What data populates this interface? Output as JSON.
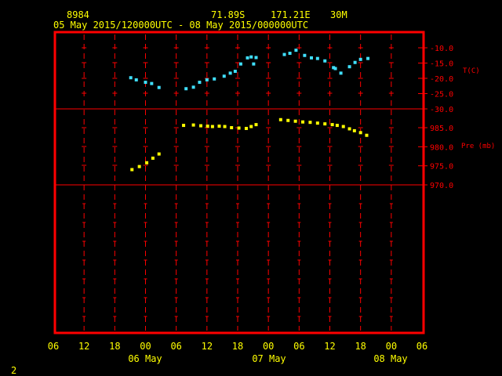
{
  "header": {
    "station": "8984",
    "lat": "71.89S",
    "lon": "171.21E",
    "elev": "30M",
    "period": "05 May 2015/120000UTC - 08 May 2015/000000UTC"
  },
  "page_number": "2",
  "colors": {
    "background": "#000000",
    "frame": "#ff0000",
    "text": "#ffff00",
    "temperature": "#40e0ff",
    "pressure": "#ffff00"
  },
  "chart_data": [
    {
      "type": "scatter",
      "xlabel": "",
      "ylabel": "T(C)",
      "ylim": [
        -30,
        -10
      ],
      "yticks": [
        "-10.0",
        "-15.0",
        "-20.0",
        "-25.0",
        "-30.0"
      ],
      "series": [
        {
          "x": [
            12.6,
            13.5,
            15.0,
            16.0,
            17.2,
            21.6,
            22.8,
            23.8,
            25.0,
            26.2,
            27.8,
            28.8,
            29.6,
            30.5,
            31.6,
            32.2,
            32.6,
            33.0,
            37.6,
            38.5,
            39.5,
            40.9,
            42.0,
            43.0,
            44.2,
            45.6,
            45.9,
            46.8,
            48.2,
            49.1,
            50.0,
            51.2
          ],
          "y": [
            -19.8,
            -20.5,
            -21.3,
            -21.7,
            -23.0,
            -23.4,
            -22.9,
            -21.3,
            -20.5,
            -20.2,
            -19.3,
            -18.3,
            -17.7,
            -15.3,
            -13.3,
            -13.0,
            -15.3,
            -13.2,
            -12.2,
            -11.8,
            -10.8,
            -12.5,
            -13.3,
            -13.5,
            -14.3,
            -16.5,
            -16.8,
            -18.3,
            -16.2,
            -14.8,
            -13.8,
            -13.5
          ]
        }
      ]
    },
    {
      "type": "scatter",
      "xlabel": "",
      "ylabel": "Pre (mb)",
      "ylim": [
        970,
        990
      ],
      "yticks": [
        "985.0",
        "980.0",
        "975.0",
        "970.0"
      ],
      "series": [
        {
          "x": [
            12.8,
            14.0,
            15.2,
            16.2,
            17.2,
            21.2,
            22.8,
            24.0,
            25.1,
            25.9,
            27.0,
            27.9,
            29.0,
            30.2,
            31.4,
            32.2,
            33.0,
            37.0,
            38.2,
            39.4,
            40.6,
            41.8,
            43.0,
            44.2,
            45.4,
            46.2,
            47.2,
            48.2,
            49.0,
            50.0,
            51.0
          ],
          "y": [
            974.0,
            974.8,
            975.8,
            977.0,
            978.1,
            985.6,
            985.7,
            985.5,
            985.4,
            985.3,
            985.4,
            985.3,
            985.0,
            984.9,
            984.8,
            985.3,
            985.8,
            987.1,
            986.9,
            986.7,
            986.5,
            986.4,
            986.2,
            986.0,
            985.8,
            985.6,
            985.3,
            984.7,
            984.2,
            983.7,
            983.0
          ]
        }
      ]
    }
  ],
  "x_axis": {
    "range_hours": [
      0,
      60
    ],
    "tick_labels": [
      "06",
      "12",
      "18",
      "00",
      "06",
      "12",
      "18",
      "00",
      "06",
      "12",
      "18",
      "00",
      "06"
    ],
    "day_labels": [
      "06 May",
      "07 May",
      "08 May"
    ]
  }
}
